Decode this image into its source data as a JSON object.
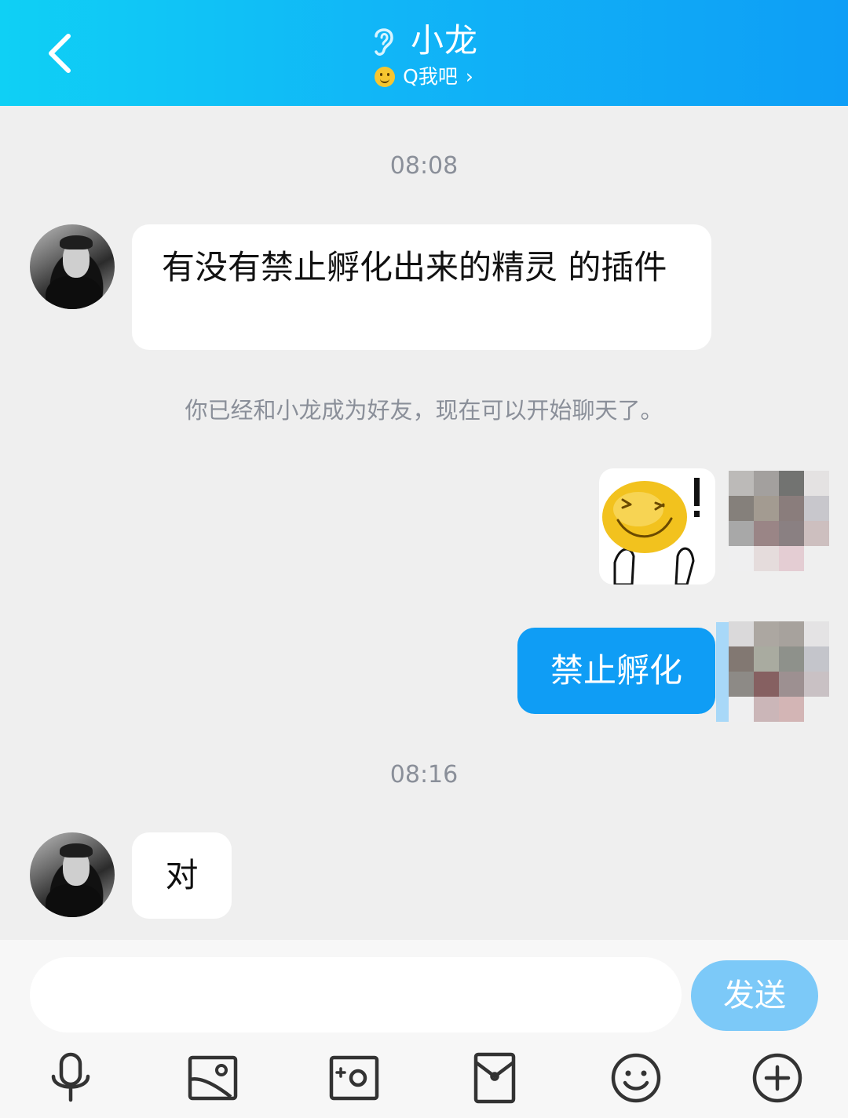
{
  "header": {
    "contact_name": "小龙",
    "subtitle": "Q我吧",
    "subtitle_chevron": "›",
    "background": "#11b6f7",
    "icons": [
      "back-arrow-icon",
      "ear-icon",
      "smile-status-icon"
    ]
  },
  "messages": {
    "time_1": "08:08",
    "incoming_1": "有没有禁止孵化出来的精灵 的插件",
    "system_note": "你已经和小龙成为好友，现在可以开始聊天了。",
    "outgoing_sticker": "surprised-smiley-sticker",
    "outgoing_text": "禁止孵化",
    "time_2": "08:16",
    "incoming_2": "对",
    "outgoing_bubble_color": "#0f9df5"
  },
  "input_bar": {
    "input_value": "",
    "input_placeholder": "",
    "send_label": "发送",
    "send_color": "#7cc9f8"
  },
  "toolbar": {
    "icons": [
      "microphone-icon",
      "image-icon",
      "camera-icon",
      "red-packet-icon",
      "emoji-icon",
      "plus-icon"
    ]
  }
}
